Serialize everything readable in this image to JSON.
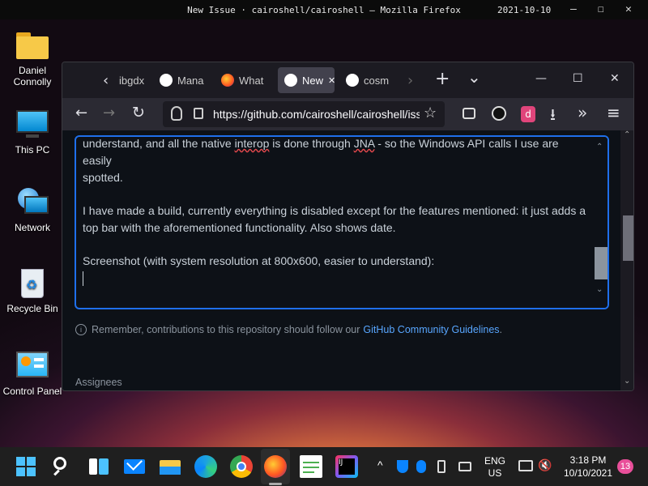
{
  "topbar": {
    "title": "New Issue · cairoshell/cairoshell — Mozilla Firefox",
    "date": "2021-10-10",
    "controls": [
      "—",
      "☐",
      "✕"
    ]
  },
  "desktop_icons": [
    {
      "label_line1": "Daniel",
      "label_line2": "Connolly",
      "icon": "folder-icon"
    },
    {
      "label_line1": "This PC",
      "label_line2": "",
      "icon": "monitor-icon"
    },
    {
      "label_line1": "Network",
      "label_line2": "",
      "icon": "network-globe-icon"
    },
    {
      "label_line1": "Recycle Bin",
      "label_line2": "",
      "icon": "recycle-bin-icon"
    },
    {
      "label_line1": "Control Panel",
      "label_line2": "",
      "icon": "control-panel-icon"
    }
  ],
  "browser": {
    "tabs": [
      {
        "label": "ibgdx",
        "icon": "partial-tab",
        "active": false
      },
      {
        "label": "Mana",
        "icon": "github-icon",
        "active": false
      },
      {
        "label": "What",
        "icon": "firefox-icon",
        "active": false
      },
      {
        "label": "New",
        "icon": "github-icon",
        "active": true,
        "close": "✕"
      },
      {
        "label": "cosm",
        "icon": "github-icon",
        "active": false
      }
    ],
    "tab_controls": {
      "scroll_left": "‹",
      "scroll_right": "›",
      "new_tab": "+",
      "list_tabs": "⌄",
      "minimize": "—",
      "maximize": "☐",
      "close": "✕"
    },
    "nav": {
      "back": "←",
      "forward": "→",
      "reload": "↻",
      "url": "https://github.com/cairoshell/cairoshell/iss",
      "bookmark": "☆",
      "overflow": "»",
      "menu": "≡",
      "badge": "d"
    },
    "editor": {
      "line1_partial": "understand, and all the native ",
      "line1_spell": "interop",
      "line1_rest": " is done through ",
      "line1_spell2": "JNA",
      "line1_end": " - so the Windows API calls I use are easily",
      "line2": "spotted.",
      "para2": "I have made a build, currently everything is disabled except for the features mentioned: it just adds a top bar with the aforementioned functionality. Also shows date.",
      "para3": "Screenshot (with system resolution at 800x600, easier to understand):"
    },
    "hint": {
      "text": "Remember, contributions to this repository should follow our",
      "link": "GitHub Community Guidelines",
      "end": "."
    },
    "assignees_label": "Assignees"
  },
  "taskbar": {
    "apps": [
      "windows-start-icon",
      "search-icon",
      "task-view-icon",
      "mail-icon",
      "file-explorer-icon",
      "edge-icon",
      "chrome-icon",
      "firefox-icon",
      "notepad-icon",
      "intellij-icon"
    ],
    "lang_top": "ENG",
    "lang_bottom": "US",
    "time": "3:18 PM",
    "date": "10/10/2021",
    "notifications": "13",
    "tray_caret": "^"
  },
  "colors": {
    "accent": "#1f6feb",
    "link": "#58a6ff",
    "editor_bg": "#0d1117",
    "text": "#c9d1d9"
  }
}
